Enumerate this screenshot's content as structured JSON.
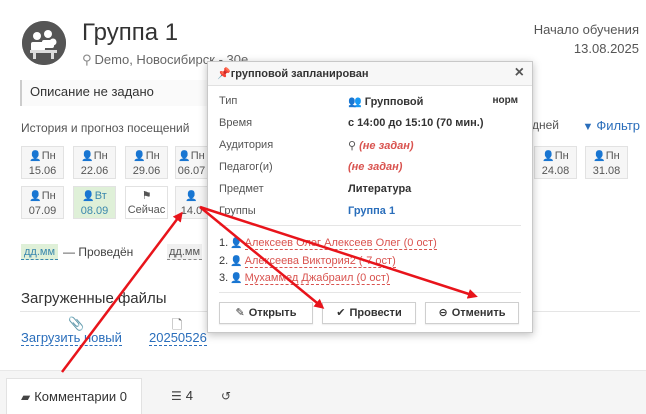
{
  "header": {
    "title": "Группа 1",
    "subtitle": "Demo, Новосибирск",
    "subtitle_suffix": "- 30е",
    "study_label": "Начало обучения",
    "study_date": "13.08.2025"
  },
  "description": "Описание не задано",
  "history_label": "История и прогноз посещений",
  "days_label": "дней",
  "filter_label": "Фильтр",
  "calendar": {
    "row1": [
      {
        "day": "Пн",
        "date": "15.06"
      },
      {
        "day": "Пн",
        "date": "22.06"
      },
      {
        "day": "Пн",
        "date": "29.06"
      },
      {
        "day": "Пн",
        "date": "06.07"
      },
      {
        "day": "Пн",
        "date": "24.08"
      },
      {
        "day": "Пн",
        "date": "31.08"
      }
    ],
    "row2": [
      {
        "day": "Пн",
        "date": "07.09"
      },
      {
        "day": "Вт",
        "date": "08.09"
      },
      {
        "day": "",
        "date": "Сейчас"
      },
      {
        "day": "",
        "date": "14.0"
      }
    ]
  },
  "legend": {
    "chip": "дд.мм",
    "text": "— Проведён",
    "chip2": "дд.мм"
  },
  "files": {
    "title": "Загруженные файлы",
    "upload_label": "Загрузить новый",
    "file_label": "20250526"
  },
  "tabs": [
    {
      "label": "Комментарии 0"
    },
    {
      "label": "4"
    },
    {
      "label": ""
    }
  ],
  "popup": {
    "title": "групповой запланирован",
    "norm": "норм",
    "rows": [
      {
        "label": "Тип",
        "value": "Групповой"
      },
      {
        "label": "Время",
        "value": "с 14:00 до 15:10 (70 мин.)"
      },
      {
        "label": "Аудитория",
        "value": "(не задан)"
      },
      {
        "label": "Педагог(и)",
        "value": "(не задан)"
      },
      {
        "label": "Предмет",
        "value": "Литература"
      },
      {
        "label": "Группы",
        "value": "Группа 1"
      }
    ],
    "students": [
      {
        "num": "1.",
        "name": "Алексеев Олег Алексеев Олег (0 ост)"
      },
      {
        "num": "2.",
        "name": "Алексеева Виктория2 (-7 ост)"
      },
      {
        "num": "3.",
        "name": "Мухаммед Джабраил (0 ост)"
      }
    ],
    "buttons": {
      "open": "Открыть",
      "conduct": "Провести",
      "cancel": "Отменить"
    }
  },
  "colors": {
    "accent": "#2a6ebb",
    "danger": "#d9534f",
    "conducted": "#dff0d8",
    "annotation_arrow": "#e8141b"
  }
}
